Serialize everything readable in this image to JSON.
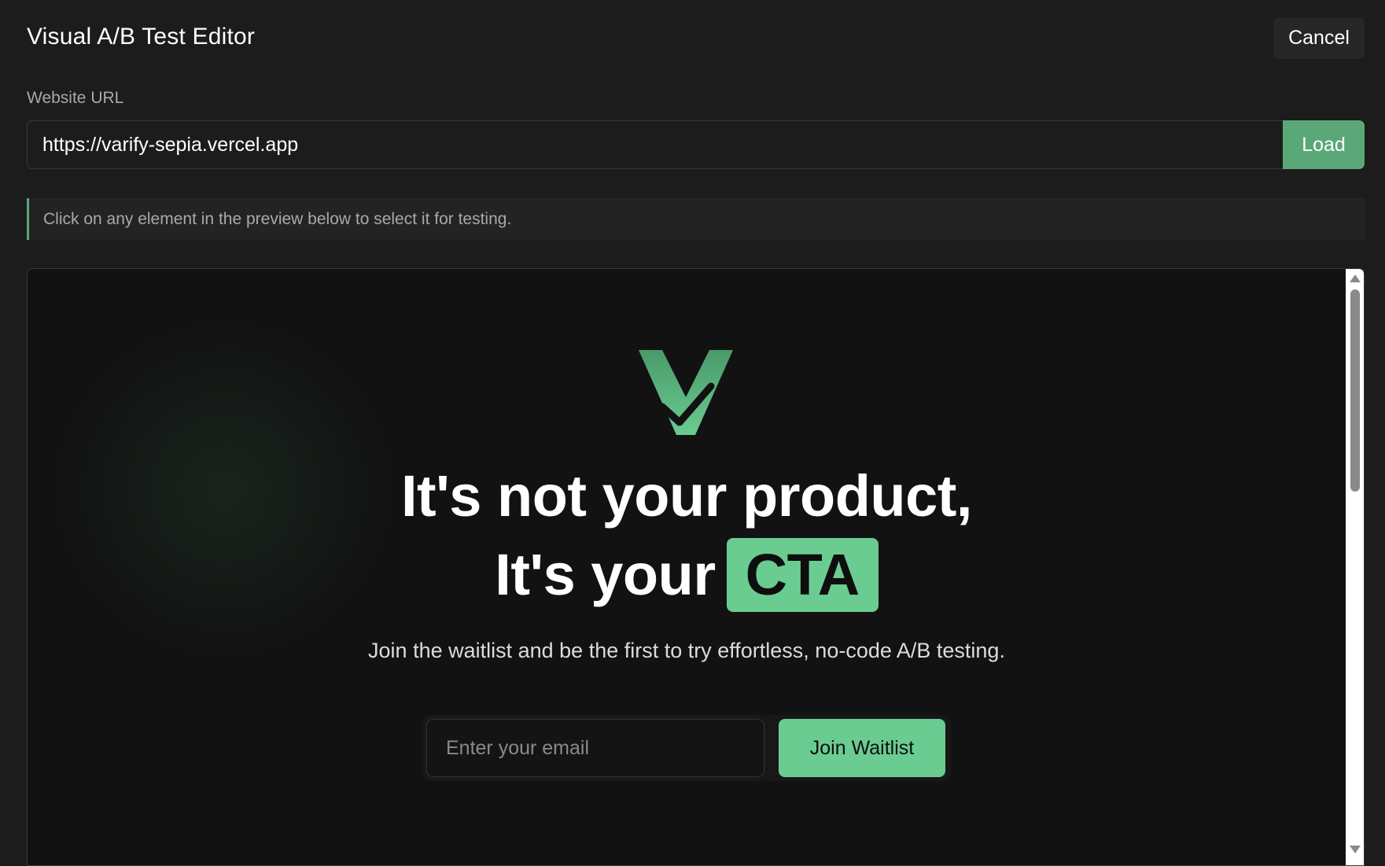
{
  "header": {
    "title": "Visual A/B Test Editor",
    "cancel_label": "Cancel"
  },
  "url_section": {
    "label": "Website URL",
    "value": "https://varify-sepia.vercel.app",
    "load_label": "Load"
  },
  "hint": {
    "text": "Click on any element in the preview below to select it for testing."
  },
  "preview": {
    "logo_icon": "varify-v-check-logo",
    "headline_line1": "It's not your product,",
    "headline_line2_prefix": "It's your",
    "headline_highlight": "CTA",
    "subtitle": "Join the waitlist and be the first to try effortless, no-code A/B testing.",
    "email_placeholder": "Enter your email",
    "join_label": "Join Waitlist"
  },
  "colors": {
    "background": "#1c1c1c",
    "accent": "#5aa878",
    "cta_green": "#6acc91",
    "preview_background": "#121212"
  }
}
